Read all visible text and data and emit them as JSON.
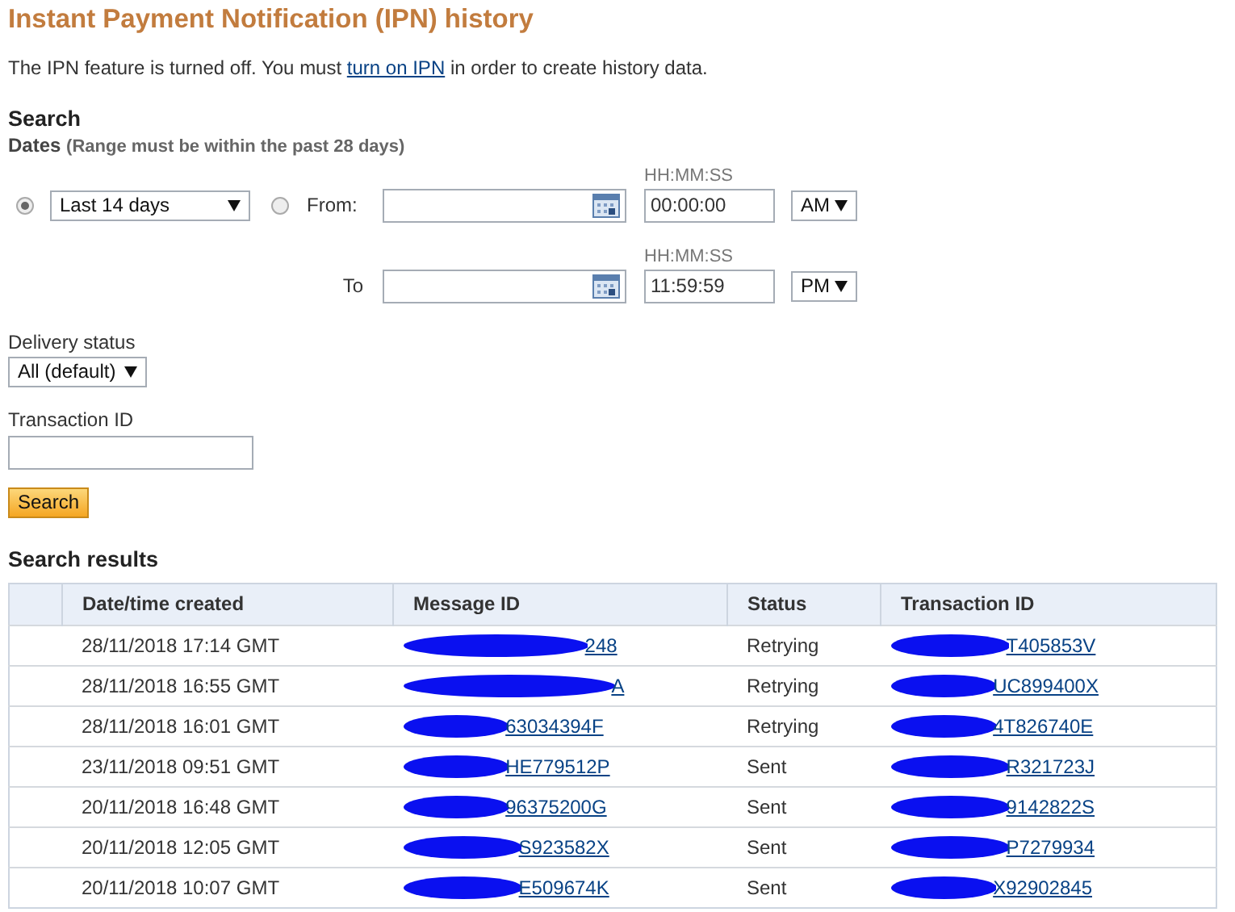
{
  "title": "Instant Payment Notification (IPN) history",
  "notice": {
    "before": "The IPN feature is turned off. You must ",
    "link": "turn on IPN",
    "after": " in order to create history data."
  },
  "search": {
    "heading": "Search",
    "dates_label": "Dates",
    "dates_hint": "(Range must be within the past 28 days)",
    "range_options": [
      {
        "selected": true,
        "value": "Last 14 days"
      },
      {
        "selected": false,
        "label": "From:"
      }
    ],
    "from": {
      "time_label": "HH:MM:SS",
      "time": "00:00:00",
      "ampm": "AM"
    },
    "to": {
      "label": "To",
      "time_label": "HH:MM:SS",
      "time": "11:59:59",
      "ampm": "PM"
    },
    "delivery_status": {
      "label": "Delivery status",
      "value": "All (default)"
    },
    "transaction_id": {
      "label": "Transaction ID"
    },
    "button": "Search"
  },
  "results": {
    "heading": "Search results",
    "columns": [
      "Date/time created",
      "Message ID",
      "Status",
      "Transaction ID"
    ],
    "rows": [
      {
        "date": "28/11/2018 17:14 GMT",
        "message_id": "248",
        "status": "Retrying",
        "transaction_id": "T405853V"
      },
      {
        "date": "28/11/2018 16:55 GMT",
        "message_id": "A",
        "status": "Retrying",
        "transaction_id": "UC899400X"
      },
      {
        "date": "28/11/2018 16:01 GMT",
        "message_id": "63034394F",
        "status": "Retrying",
        "transaction_id": "4T826740E"
      },
      {
        "date": "23/11/2018 09:51 GMT",
        "message_id": "HE779512P",
        "status": "Sent",
        "transaction_id": "R321723J"
      },
      {
        "date": "20/11/2018 16:48 GMT",
        "message_id": "96375200G",
        "status": "Sent",
        "transaction_id": "9142822S"
      },
      {
        "date": "20/11/2018 12:05 GMT",
        "message_id": "S923582X",
        "status": "Sent",
        "transaction_id": "P7279934"
      },
      {
        "date": "20/11/2018 10:07 GMT",
        "message_id": "E509674K",
        "status": "Sent",
        "transaction_id": "X92902845"
      }
    ]
  }
}
